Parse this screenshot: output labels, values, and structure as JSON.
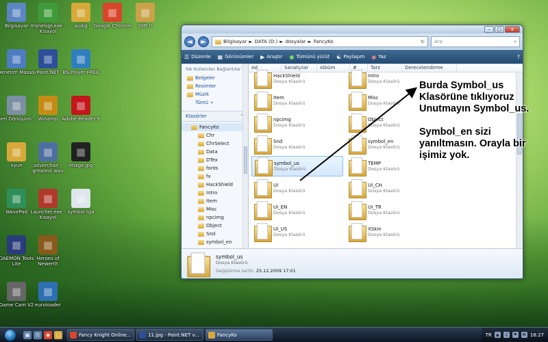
{
  "desktop_icons": [
    {
      "label": "Bilgisayar",
      "icon": "computer-icon",
      "color": "#5b86c2"
    },
    {
      "label": "msnmsgr.exe - Kısayol",
      "icon": "msn-icon",
      "color": "#3f9b3a"
    },
    {
      "label": "audig",
      "icon": "folder-icon",
      "color": "#d7a93a"
    },
    {
      "label": "Google Chrome",
      "icon": "chrome-icon",
      "color": "#d9452b"
    },
    {
      "label": "ŞİİR:!!",
      "icon": "folder-music-icon",
      "color": "#c9a24a"
    },
    {
      "label": "Denetim Masası",
      "icon": "control-panel-icon",
      "color": "#4e7cc0"
    },
    {
      "label": "Paint.NET",
      "icon": "paintnet-icon",
      "color": "#2d4f9a"
    },
    {
      "label": "BS.Player FREE",
      "icon": "bsplayer-icon",
      "color": "#2f7fbf"
    },
    {
      "label": "Geri Dönüşüm...",
      "icon": "recycle-bin-icon",
      "color": "#7d8fa3"
    },
    {
      "label": "Winamp",
      "icon": "winamp-icon",
      "color": "#c58c15"
    },
    {
      "label": "Adobe Reader 9",
      "icon": "adobe-reader-icon",
      "color": "#c4161c"
    },
    {
      "label": "oyun",
      "icon": "folder-icon",
      "color": "#d7a93a"
    },
    {
      "label": "silverchair - greatest.wav",
      "icon": "folder-icon",
      "color": "#4f6fa0"
    },
    {
      "label": "image.jpg",
      "icon": "image-icon",
      "color": "#222222"
    },
    {
      "label": "WavePad",
      "icon": "wavepad-icon",
      "color": "#2f8f5a"
    },
    {
      "label": "Launcher.exe - Kısayol",
      "icon": "launcher-icon",
      "color": "#b0392b"
    },
    {
      "label": "symbol.tga",
      "icon": "tga-file-icon",
      "color": "#dfe6ee"
    },
    {
      "label": "DAEMON Tools Lite",
      "icon": "daemon-tools-icon",
      "color": "#2a3b7a"
    },
    {
      "label": "Heroes of Newerth",
      "icon": "hon-icon",
      "color": "#8a5a1c"
    },
    {
      "label": "Game Cam V2",
      "icon": "gamecam-icon",
      "color": "#666666"
    },
    {
      "label": "euroloader",
      "icon": "euroloader-icon",
      "color": "#2d6fb3"
    }
  ],
  "window": {
    "controls": {
      "minimize": "–",
      "maximize": "□",
      "close": "x"
    },
    "address": {
      "back": "◄",
      "forward": "►",
      "segments": [
        "Bilgisayar",
        "DATA (D:)",
        "dosyalar",
        "FancyKo"
      ],
      "separator": "►",
      "refresh": "↻"
    },
    "search_placeholder": "Ara",
    "toolbar": {
      "organize": "Düzenle",
      "views": "Görünümler",
      "explore": "Araştır",
      "play_all": "Tümünü yürüt",
      "share": "Paylaşım",
      "burn": "Yaz",
      "help": "?"
    },
    "nav": {
      "header": "Sık Kullanılan Bağlantılar",
      "favorites": [
        "Belgeler",
        "Resimler",
        "Müzik"
      ],
      "more": "Tümü",
      "more_arrow": "»",
      "folders_header": "Klasörler",
      "tree": [
        "FancyKo",
        "Chr",
        "ChrSelect",
        "Data",
        "DTex",
        "fonts",
        "fx",
        "HackShield",
        "Intro",
        "Item",
        "Misc",
        "npcimg",
        "Object",
        "Snd",
        "symbol_en"
      ]
    },
    "columns": [
      "Ad",
      "Sanatçılar",
      "Albüm",
      "#",
      "Tarz",
      "Derecelendirme"
    ],
    "folder_type": "Dosya Klasörü",
    "items_left": [
      "HackShield",
      "Item",
      "npcimg",
      "Snd",
      "symbol_us",
      "UI",
      "UI_EN",
      "UI_US"
    ],
    "items_right": [
      "Intro",
      "Misc",
      "Object",
      "symbol_en",
      "TEMP",
      "UI_CH",
      "UI_TR",
      "XSkin"
    ],
    "details": {
      "name": "symbol_us",
      "type": "Dosya Klasörü",
      "date_label": "Değiştirme tarihi:",
      "date": "25.12.2009 17:01"
    }
  },
  "annotation": [
    "Burda Symbol_us Klasörüne tıklıyoruz Unutmayın Symbol_us.",
    "Symbol_en sizi yanıltmasın. Orayla bir işimiz yok."
  ],
  "taskbar": {
    "tasks": [
      "Fancy Knight Online...",
      "11.jpg - Paint.NET v...",
      "FancyKo"
    ],
    "lang": "TR",
    "clock": "18:27"
  }
}
